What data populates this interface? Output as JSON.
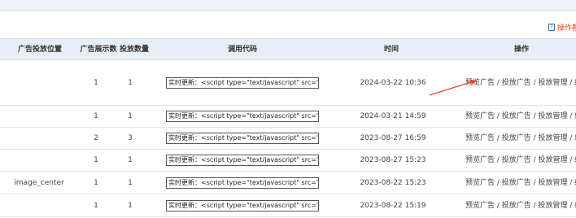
{
  "header": {
    "help_label": "操作教",
    "help_icon": "question-icon"
  },
  "table": {
    "columns": [
      "广告投放位置",
      "广告展示数",
      "投放数量",
      "调用代码",
      "时间",
      "操作"
    ],
    "rows": [
      {
        "position": "",
        "display_count": "1",
        "quantity": "1",
        "code": "实时更新：<script type=\"text/javascript\" src=\"/j",
        "time": "2024-03-22 10:36",
        "ops": "预览广告 / 投放广告 / 投放管理 / 编辑"
      },
      {
        "position": "",
        "display_count": "1",
        "quantity": "1",
        "code": "实时更新：<script type=\"text/javascript\" src=\"/j",
        "time": "2024-03-21 14:59",
        "ops": "预览广告 / 投放广告 / 投放管理 / 编辑"
      },
      {
        "position": "",
        "display_count": "2",
        "quantity": "3",
        "code": "实时更新：<script type=\"text/javascript\" src=\"/j",
        "time": "2023-08-27 16:59",
        "ops": "预览广告 / 投放广告 / 投放管理 / 编辑"
      },
      {
        "position": "",
        "display_count": "1",
        "quantity": "1",
        "code": "实时更新：<script type=\"text/javascript\" src=\"/j",
        "time": "2023-08-27 15:23",
        "ops": "预览广告 / 投放广告 / 投放管理 / 编辑"
      },
      {
        "position": "image_center",
        "display_count": "1",
        "quantity": "1",
        "code": "实时更新：<script type=\"text/javascript\" src=\"/j",
        "time": "2023-08-22 15:23",
        "ops": "预览广告 / 投放广告 / 投放管理 / 编辑"
      },
      {
        "position": "",
        "display_count": "1",
        "quantity": "1",
        "code": "实时更新：<script type=\"text/javascript\" src=\"/j",
        "time": "2023-08-22 15:19",
        "ops": "预览广告 / 投放广告 / 投放管理 / 编辑"
      }
    ]
  },
  "colors": {
    "header_bg": "#e8eef5",
    "annotation_red": "#e64520",
    "help_link": "#e64520"
  }
}
